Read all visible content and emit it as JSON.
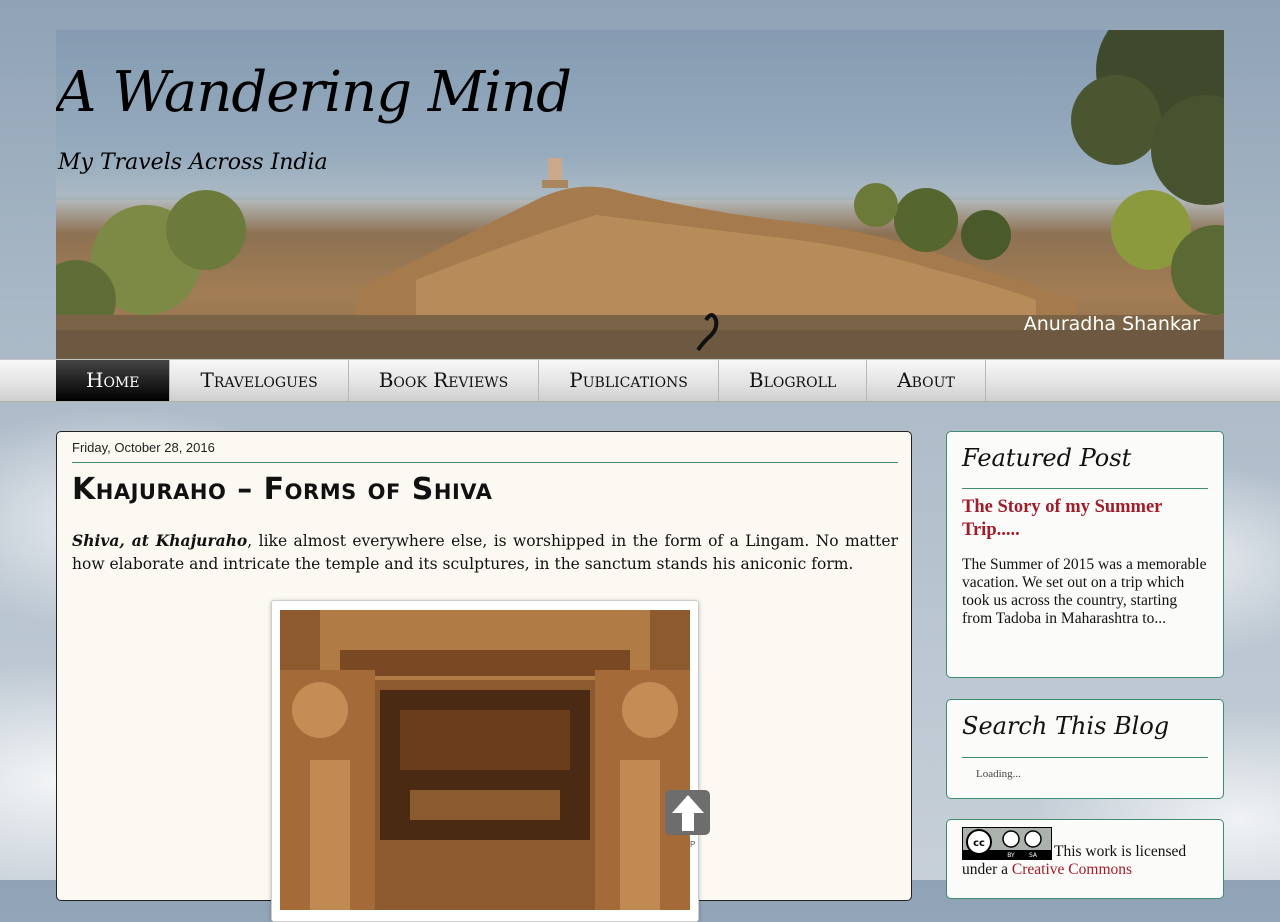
{
  "header": {
    "title": "A Wandering Mind",
    "description": "My Travels Across India",
    "watermark": "Anuradha Shankar"
  },
  "nav": {
    "items": [
      {
        "label": "Home"
      },
      {
        "label": "Travelogues"
      },
      {
        "label": "Book Reviews"
      },
      {
        "label": "Publications"
      },
      {
        "label": "Blogroll"
      },
      {
        "label": "About"
      }
    ]
  },
  "post": {
    "date": "Friday, October 28, 2016",
    "title": "Khajuraho – Forms of Shiva",
    "intro_bold": "Shiva, at Khajuraho",
    "intro_rest": ", like almost everywhere else, is worshipped in the form of a Lingam. No matter how elaborate and intricate the temple and its sculptures, in the sanctum stands his aniconic form."
  },
  "back_to_top": {
    "label": "P"
  },
  "sidebar": {
    "featured": {
      "heading": "Featured Post",
      "link": "The Story of my Summer Trip.....",
      "snippet": "The Summer of 2015 was a memorable vacation. We set out on a trip which took us across the country, starting from Tadoba in Maharashtra to..."
    },
    "search": {
      "heading": "Search This Blog",
      "status": "Loading..."
    },
    "license": {
      "text": "This work is licensed under a ",
      "link": "Creative Commons"
    }
  },
  "colors": {
    "accent_green": "#3e8d72",
    "link_red": "#a11c2a",
    "nav_active": "#000000"
  },
  "icons": [
    "back-to-top-arrow-icon",
    "creative-commons-by-sa-icon"
  ]
}
